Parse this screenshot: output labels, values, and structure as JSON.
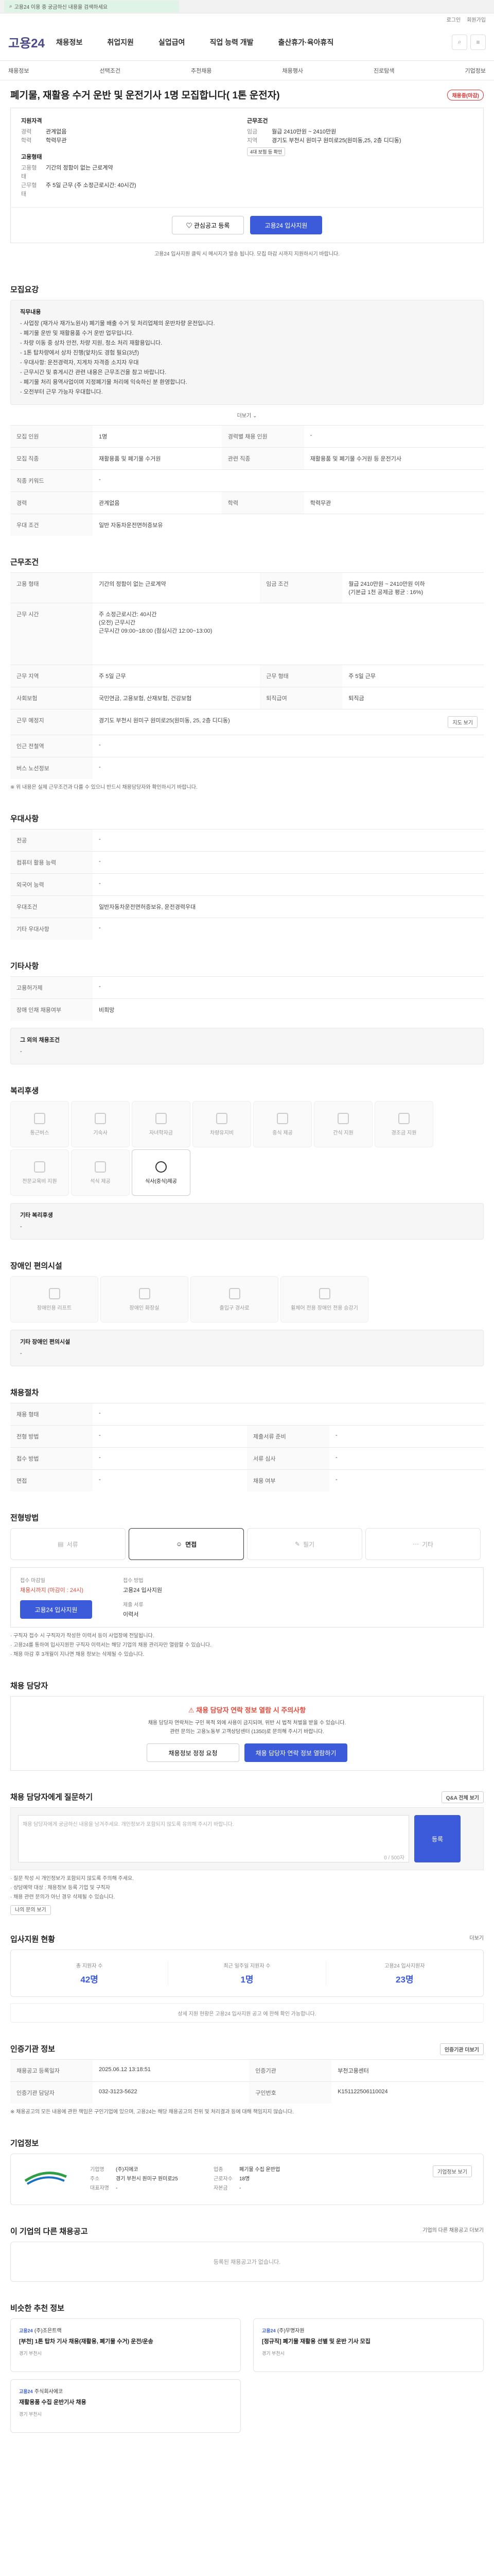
{
  "topbar": {
    "text": "고용24 이용 중 궁금하신 내용을 검색하세요"
  },
  "util": [
    "로그인",
    "회원가입"
  ],
  "header": {
    "logo": "고용24",
    "gnb": [
      "채용정보",
      "취업지원",
      "실업급여",
      "직업 능력 개발",
      "출산휴가·육아휴직"
    ]
  },
  "subnav": {
    "items": [
      "채용정보",
      "선택조건",
      "추천채용",
      "채용행사",
      "진로탐색",
      "기업정보"
    ]
  },
  "job": {
    "title": "폐기물, 재활용 수거 운반 및 운전기사 1명 모집합니다( 1톤 운전자)",
    "status_badge": "채용중(마감)",
    "applicant": {
      "heading": "지원자격",
      "rows": [
        {
          "k": "경력",
          "v": "관계없음"
        },
        {
          "k": "학력",
          "v": "학력무관"
        }
      ]
    },
    "condition": {
      "heading": "근무조건",
      "rows": [
        {
          "k": "임금",
          "v": "월급 2410만원 ~ 2410만원"
        },
        {
          "k": "지역",
          "v": "경기도 부천시 원미구 원미로25(원미동,25, 2층 디디동)"
        }
      ]
    },
    "employment": {
      "heading": "고용형태",
      "rows": [
        {
          "k": "고용형태",
          "v": "기간의 정함이 없는 근로계약"
        },
        {
          "k": "근무형태",
          "v": "주 5일 근무 (주 소정근로시간: 40시간)"
        }
      ]
    },
    "condition_tag": "4대 보험 등 확인",
    "buttons": {
      "save": "관심공고 등록",
      "apply": "고용24 입사지원"
    },
    "notice": "고용24 입사지원 클릭 시 메시지가 발송 됩니다. 모집 마감 시까지 지원하시기 바랍니다."
  },
  "sections": {
    "recruit": {
      "title": "모집요강",
      "desc_title": "직무내용",
      "desc": [
        "- 사업장 (재가사 재가노원사) 폐기물 배출 수거 및 처리업체의 운반차량 운전입니다.",
        "- 폐기물 운반 및 재활용품 수거 운반 업무입니다.",
        "- 차량 이동 중 상차 안전, 차량 지원, 청소 처리 재활용입니다.",
        "- 1톤 탑차량에서 상차 진행(앞차)도 경험 필요(3년)",
        "- 우대사항: 운전경력자, 지게차 자격증 소지자 우대",
        "- 근무시간 및 휴게시간 관련 내용은 근무조건을 참고 바랍니다.",
        "- 폐기물 처리 용역사업이며 지정폐기물 처리에 익숙하신 분 환영합니다.",
        "- 오전부터 근무 가능자 우대합니다."
      ],
      "more": "더보기",
      "rows": [
        {
          "k": "모집 인원",
          "v": "1명",
          "k2": "경력별 채용 인원",
          "v2": "-"
        },
        {
          "k": "모집 직종",
          "v": "재활용품 및 폐기물 수거원",
          "k2": "관련 직종",
          "v2": "재활용품 및 폐기물 수거원 등 운전기사"
        },
        {
          "k": "직종 키워드",
          "v": "-",
          "k2": "",
          "v2": ""
        },
        {
          "k": "경력",
          "v": "관계없음",
          "k2": "학력",
          "v2": "학력무관"
        },
        {
          "k": "우대 조건",
          "v": "일반 자동차운전면허증보유",
          "k2": "",
          "v2": ""
        }
      ]
    },
    "work": {
      "title": "근무조건",
      "rows": [
        {
          "k": "고용 형태",
          "v": "기간의 정함이 없는 근로계약",
          "k2": "임금 조건",
          "v2": "월급 2410만원 ~ 2410만원 이하\n(기본급 1천 공제금 평균 : 16%)"
        },
        {
          "k": "근무 시간",
          "v": "주 소정근로시간: 40시간\n(오전) 근무시간\n근무시간 09:00~18:00 (점심시간 12:00~13:00)",
          "k2": "",
          "v2": ""
        },
        {
          "k": "근무 지역",
          "v": "주 5일 근무",
          "k2": "근무 형태",
          "v2": "주 5일 근무"
        },
        {
          "k": "사회보험",
          "v": "국민연금, 고용보험, 산재보험, 건강보험",
          "k2": "퇴직급여",
          "v2": "퇴직금"
        },
        {
          "k": "근무 예정지",
          "v": "경기도 부천시 원미구 원미로25(원미동, 25, 2층 디디동)",
          "k2": "",
          "v2": ""
        },
        {
          "k": "인근 전철역",
          "v": "-",
          "k2": "",
          "v2": ""
        },
        {
          "k": "버스 노선정보",
          "v": "-",
          "k2": "",
          "v2": ""
        }
      ],
      "map_btn": "지도 보기",
      "notice": "※ 위 내용은 실제 근무조건과 다를 수 있으니 반드시 채용담당자와 확인하시기 바랍니다."
    },
    "extra": {
      "title": "우대사항",
      "rows": [
        {
          "k": "전공",
          "v": "-"
        },
        {
          "k": "컴퓨터 활용 능력",
          "v": "-"
        },
        {
          "k": "외국어 능력",
          "v": "-"
        },
        {
          "k": "우대조건",
          "v": "일반자동차운전면허증보유, 운전경력우대"
        },
        {
          "k": "기타 우대사항",
          "v": "-"
        }
      ]
    },
    "etc": {
      "title": "기타사항",
      "rows": [
        {
          "k": "고용허가제",
          "v": "-"
        },
        {
          "k": "장애 인채 채용여부",
          "v": "비희망"
        }
      ],
      "misc_title": "그 외의 채용조건",
      "misc": "-"
    },
    "welfare": {
      "title": "복리후생",
      "items": [
        "통근버스",
        "기숙사",
        "자녀학자금",
        "차량유지비",
        "중식 제공",
        "간식 지원",
        "경조금 지원",
        "전문교육비 지원",
        "석식 제공",
        "식사(중식)제공"
      ],
      "active_index": 9,
      "etc_label": "기타 복리후생",
      "etc_value": "-"
    },
    "disabled": {
      "title": "장애인 편의시설",
      "items": [
        "장애인용 리프트",
        "장애인 화장실",
        "출입구 경사로",
        "휠체어 전용 장애인 전용 승강기"
      ],
      "etc_label": "기타 장애인 편의시설",
      "etc_value": "-"
    },
    "process": {
      "title": "채용절차",
      "rows": [
        {
          "k": "채용 형태",
          "v": "-",
          "k2": "",
          "v2": ""
        },
        {
          "k": "전형 방법",
          "v": "-",
          "k2": "제출서류 준비",
          "v2": "-"
        },
        {
          "k": "접수 방법",
          "v": "-",
          "k2": "서류 심사",
          "v2": "-"
        },
        {
          "k": "면접",
          "v": "-",
          "k2": "채용 여부",
          "v2": "-"
        }
      ]
    },
    "selection": {
      "title": "전형방법",
      "steps": [
        "서류",
        "면접",
        "필기",
        "기타"
      ],
      "active": 1
    },
    "apply": {
      "deadline_label": "접수 마감일",
      "deadline_value": "채용시까지 (마감이 : 24시)",
      "method_label": "접수 방법",
      "method_value": "고용24 입사지원",
      "docs_label": "제출 서류",
      "docs_value": "이력서",
      "button": "고용24 입사지원",
      "notes": [
        "구직자 접수 시 구직자가 작성한 이력서 등이 사업장에 전달됩니다.",
        "고용24를 통하여 입사지원한 구직자 이력서는 해당 기업의 채용 관리자만 열람할 수 있습니다.",
        "채용 마감 후 3개월이 지나면 채용 정보는 삭제될 수 있습니다."
      ]
    },
    "manager": {
      "title": "채용 담당자",
      "warn_title": "채용 담당자 연락 정보 열람 시 주의사항",
      "warn_text": [
        "채용 담당자 연락처는 구인 목적 외에 사용이 금지되며, 위반 시 법적 처벌을 받을 수 있습니다.",
        "관련 문의는 고용노동부 고객상담센터 (1350)로 문의해 주시기 바랍니다."
      ],
      "btn1": "채용정보 정정 요청",
      "btn2": "채용 담당자 연락 정보 열람하기"
    },
    "qa": {
      "title": "채용 담당자에게 질문하기",
      "link": "Q&A 전체 보기",
      "placeholder": "채용 담당자에게 궁금하신 내용을 남겨주세요. 개인정보가 포함되지 않도록 유의해 주시기 바랍니다.",
      "counter": "0 / 500자",
      "submit": "등록",
      "notes": [
        "질문 작성 시 개인정보가 포함되지 않도록 주의해 주세요.",
        "상담예약 대상 : 채용정보 등록 기업 및 구직자",
        "채용 관련 문의가 아닌 경우 삭제될 수 있습니다."
      ],
      "small_btn": "나의 문의 보기"
    },
    "stats": {
      "title": "입사지원 현황",
      "link": "더보기",
      "items": [
        {
          "label": "총 지원자 수",
          "value": "42명"
        },
        {
          "label": "최근 일주일 지원자 수",
          "value": "1명"
        },
        {
          "label": "고용24 입사지원자",
          "value": "23명"
        }
      ],
      "chart_text": "상세 지원 현황은 고용24 입사지원 공고 에 한해 확인 가능합니다."
    },
    "reg": {
      "title": "인증기관 정보",
      "btn": "인증기관 더보기",
      "rows": [
        {
          "k": "채용공고 등록일자",
          "v": "2025.06.12 13:18:51",
          "k2": "인증기관",
          "v2": "부천고용센터"
        },
        {
          "k": "인증기관 담당자",
          "v": "032-3123-5622",
          "k2": "구인번호",
          "v2": "K151122506110024"
        }
      ],
      "note": "※ 채용공고의 모든 내용에 관한 책임은 구인기업에 있으며, 고용24는 해당 채용공고의 진위 및 처리결과 등에 대해 책임지지 않습니다."
    },
    "company": {
      "title": "기업정보",
      "logo": "지에코",
      "btn": "기업정보 보기",
      "rows": [
        {
          "k": "기업명",
          "v": "(주)지에코",
          "k2": "업종",
          "v2": "폐기물 수집 운반업"
        },
        {
          "k": "주소",
          "v": "경기 부천시 원미구 원미로25",
          "k2": "근로자수",
          "v2": "18명"
        },
        {
          "k": "대표자명",
          "v": "-",
          "k2": "자본금",
          "v2": "-"
        }
      ]
    },
    "similar": {
      "title": "이 기업의 다른 채용공고",
      "link": "기업의 다른 채용공고 더보기",
      "empty": "등록된 채용공고가 없습니다."
    },
    "recommend": {
      "title": "비슷한 추천 정보",
      "jobs": [
        {
          "logo": "고용24",
          "company": "(주)조은트랙",
          "title": "[부천] 1톤 탑차 기사 채용(재활용, 폐기물 수거) 운전/운송",
          "loc": "경기 부천시"
        },
        {
          "logo": "고용24",
          "company": "(주)무명자원",
          "title": "[정규직] 폐기물 재활용 선별 및 운반 기사 모집",
          "loc": "경기 부천시"
        },
        {
          "logo": "고용24",
          "company": "주식회사에코",
          "title": "재활용품 수집 운반기사 채용",
          "loc": "경기 부천시"
        }
      ]
    }
  },
  "colors": {
    "primary": "#3b5bdb",
    "danger": "#e54c3c",
    "brand": "#4a4a8a"
  }
}
